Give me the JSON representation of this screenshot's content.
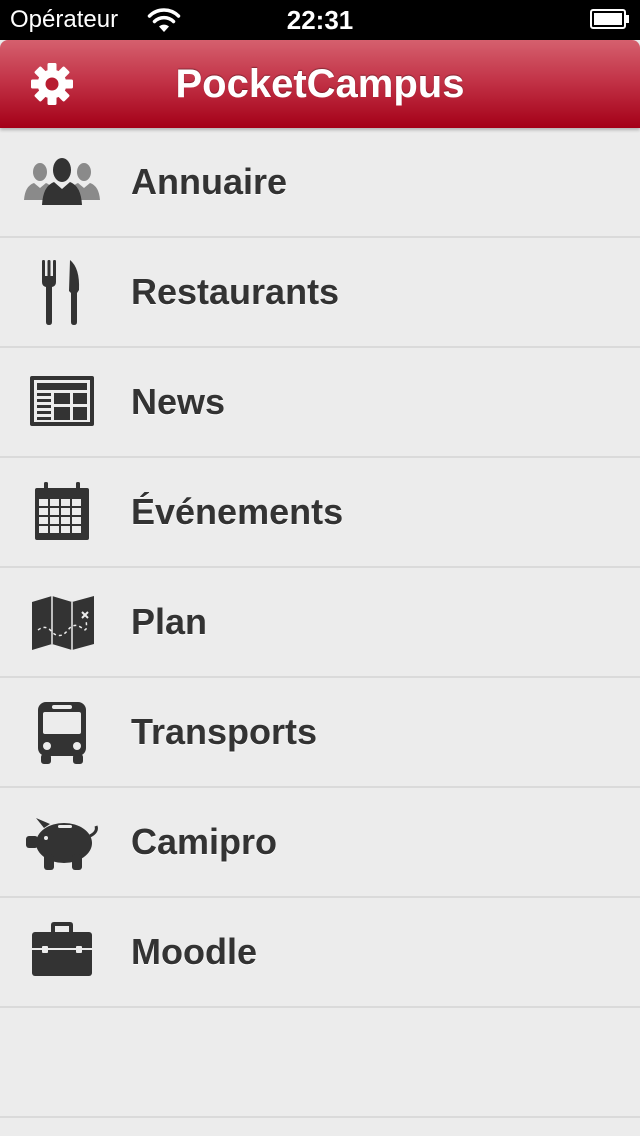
{
  "status_bar": {
    "carrier": "Opérateur",
    "time": "22:31"
  },
  "nav_bar": {
    "title": "PocketCampus",
    "settings_icon": "gear-icon"
  },
  "menu": {
    "items": [
      {
        "label": "Annuaire",
        "icon": "people-icon"
      },
      {
        "label": "Restaurants",
        "icon": "fork-knife-icon"
      },
      {
        "label": "News",
        "icon": "newspaper-icon"
      },
      {
        "label": "Événements",
        "icon": "calendar-icon"
      },
      {
        "label": "Plan",
        "icon": "map-icon"
      },
      {
        "label": "Transports",
        "icon": "bus-icon"
      },
      {
        "label": "Camipro",
        "icon": "piggy-bank-icon"
      },
      {
        "label": "Moodle",
        "icon": "briefcase-icon"
      }
    ]
  },
  "colors": {
    "nav_top": "#d5606e",
    "nav_bottom": "#a40018",
    "list_background": "#ececec",
    "separator": "#dadada",
    "label_text": "#333333",
    "icon_color": "#333333"
  }
}
